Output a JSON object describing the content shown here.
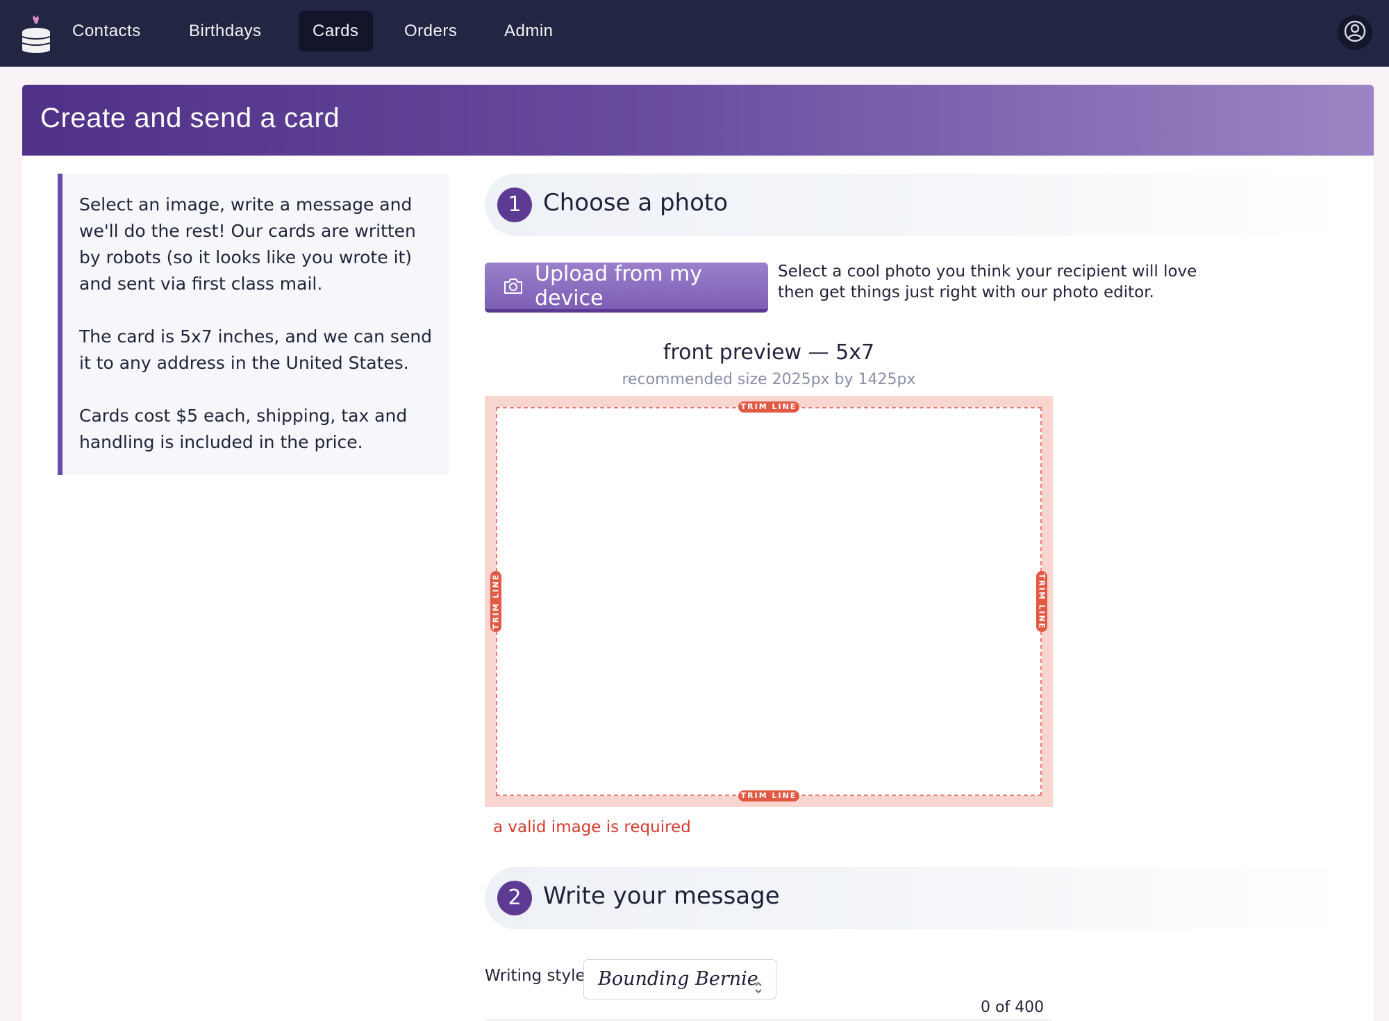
{
  "nav": {
    "logo_icon": "cake-icon",
    "items": [
      {
        "label": "Contacts",
        "active": false
      },
      {
        "label": "Birthdays",
        "active": false
      },
      {
        "label": "Cards",
        "active": true
      },
      {
        "label": "Orders",
        "active": false
      },
      {
        "label": "Admin",
        "active": false
      }
    ],
    "account_icon": "user-circle-icon"
  },
  "page": {
    "title": "Create and send a card",
    "info": [
      "Select an image, write a message and we'll do the rest! Our cards are written by robots (so it looks like you wrote it) and sent via first class mail.",
      "The card is 5x7 inches, and we can send it to any address in the United States.",
      "Cards cost $5 each, shipping, tax and handling is included in the price."
    ]
  },
  "step1": {
    "number": "1",
    "title": "Choose a photo",
    "upload_label": "Upload from my device",
    "upload_icon": "camera-icon",
    "help": "Select a cool photo you think your recipient will love then get things just right with our photo editor.",
    "preview_title": "front preview — 5x7",
    "preview_sub": "recommended size 2025px by 1425px",
    "trim_label": "TRIM LINE",
    "error": "a valid image is required"
  },
  "step2": {
    "number": "2",
    "title": "Write your message",
    "style_label": "Writing style",
    "style_value": "Bounding Bernie",
    "counter": "0 of 400"
  },
  "colors": {
    "nav_bg": "#222642",
    "accent": "#5d3b95",
    "error": "#d63a2e",
    "trim": "#e05a44"
  }
}
